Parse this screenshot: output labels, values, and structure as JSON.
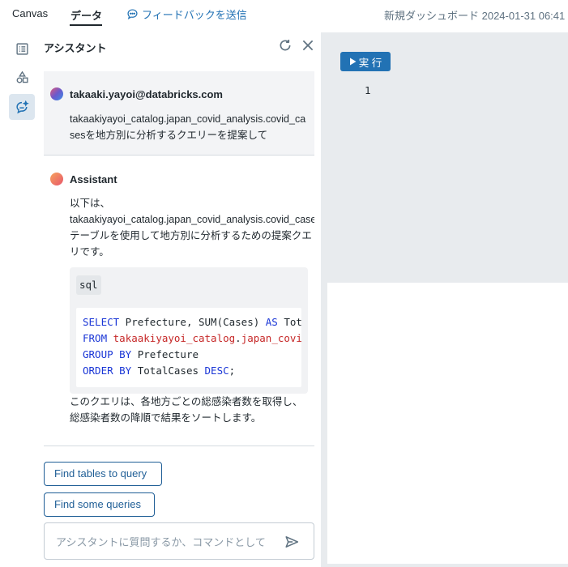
{
  "topbar": {
    "tab_canvas": "Canvas",
    "tab_data": "データ",
    "feedback": "フィードバックを送信",
    "dashboard_title": "新規ダッシュボード 2024-01-31 06:41"
  },
  "assistant": {
    "title": "アシスタント",
    "user": {
      "name": "takaaki.yayoi@databricks.com",
      "message": "takaakiyayoi_catalog.japan_covid_analysis.covid_casesを地方別に分析するクエリーを提案して"
    },
    "reply": {
      "name": "Assistant",
      "intro_lines": [
        "以下は、",
        "takaakiyayoi_catalog.japan_covid_analysis.covid_cases",
        "テーブルを使用して地方別に分析するための提案クエ",
        "リです。"
      ],
      "code_lang": "sql",
      "code": {
        "line1_kw1": "SELECT",
        "line1_rest": " Prefecture, SUM(Cases) ",
        "line1_kw2": "AS",
        "line1_tail": " TotalCases",
        "line2_kw": "FROM",
        "line2_id1": "takaakiyayoi_catalog",
        "line2_dot": ".",
        "line2_id2": "japan_covid_analysis.covid_cases",
        "line3_kw": "GROUP BY",
        "line3_rest": " Prefecture",
        "line4_kw": "ORDER BY",
        "line4_rest": " TotalCases ",
        "line4_kw2": "DESC",
        "line4_end": ";"
      },
      "outro": "このクエリは、各地方ごとの総感染者数を取得し、総感染者数の降順で結果をソートします。"
    },
    "suggestions": [
      "Find tables to query",
      "Find some queries"
    ],
    "input_placeholder": "アシスタントに質問するか、コマンドとして"
  },
  "editor": {
    "run_label": "実 行",
    "line_number": "1"
  },
  "colors": {
    "accent": "#2272b4",
    "keyword": "#1a36d6",
    "identifier": "#c62828",
    "editor_bg": "#e8ebee"
  },
  "icons": {
    "feedback": "chat-bubble-icon",
    "rail": [
      "list-icon",
      "shapes-icon",
      "assistant-icon"
    ],
    "refresh": "refresh-icon",
    "close": "close-icon",
    "send": "send-icon",
    "run": "play-icon"
  }
}
